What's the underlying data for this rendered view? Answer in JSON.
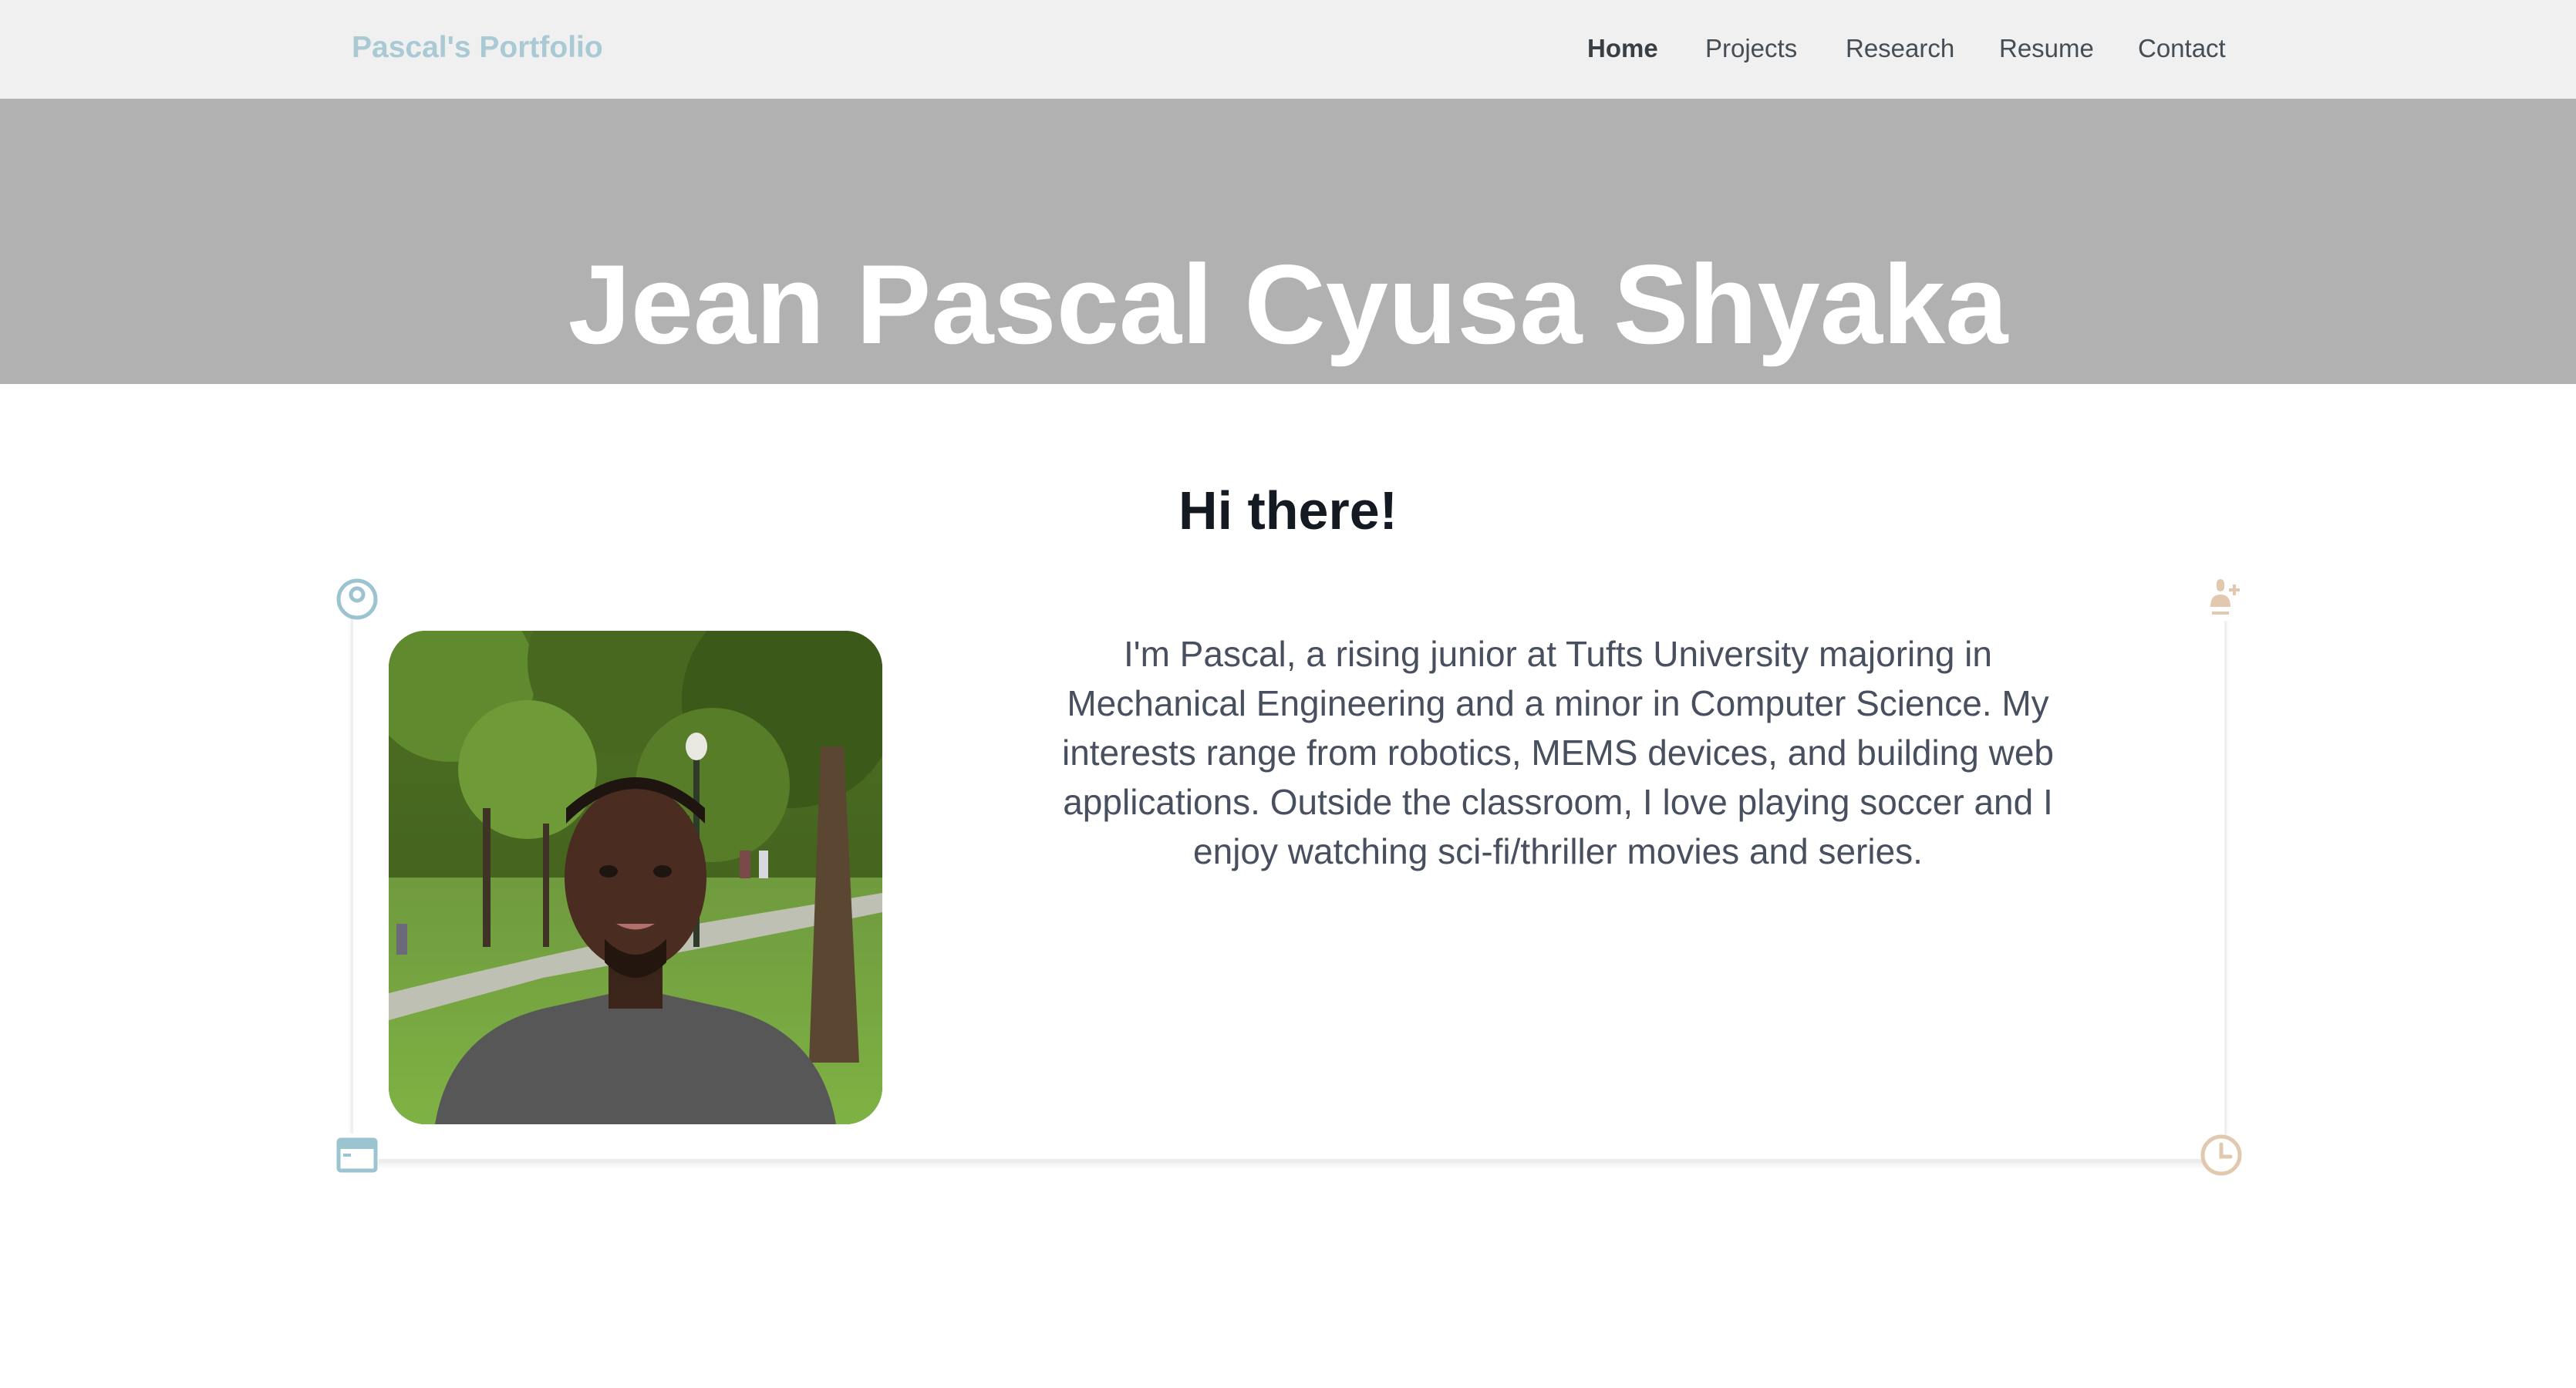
{
  "navbar": {
    "brand": "Pascal's Portfolio",
    "links": [
      {
        "label": "Home",
        "active": true
      },
      {
        "label": "Projects",
        "active": false
      },
      {
        "label": "Research",
        "active": false
      },
      {
        "label": "Resume",
        "active": false
      },
      {
        "label": "Contact",
        "active": false
      }
    ]
  },
  "hero": {
    "title": "Jean Pascal Cyusa Shyaka"
  },
  "main": {
    "heading": "Hi there!",
    "bio": "I'm Pascal, a rising junior at Tufts University majoring in Mechanical Engineering and a minor in Computer Science. My interests range from robotics, MEMS devices, and building web applications. Outside the classroom, I love playing soccer and I enjoy watching sci-fi/thriller movies and series.",
    "photo_icon": "profile-photo",
    "corner_icons": [
      "target-icon",
      "user-add-icon",
      "browser-window-icon",
      "clock-icon"
    ]
  },
  "colors": {
    "navbar_bg": "#f0f0f0",
    "brand": "#a9cad4",
    "hero_bg": "#b1b1b1",
    "hero_text": "#ffffff",
    "heading_text": "#141a22",
    "bio_text": "#484f5e",
    "icon_blue": "#9bc3d0",
    "icon_tan": "#e3c8b0"
  }
}
